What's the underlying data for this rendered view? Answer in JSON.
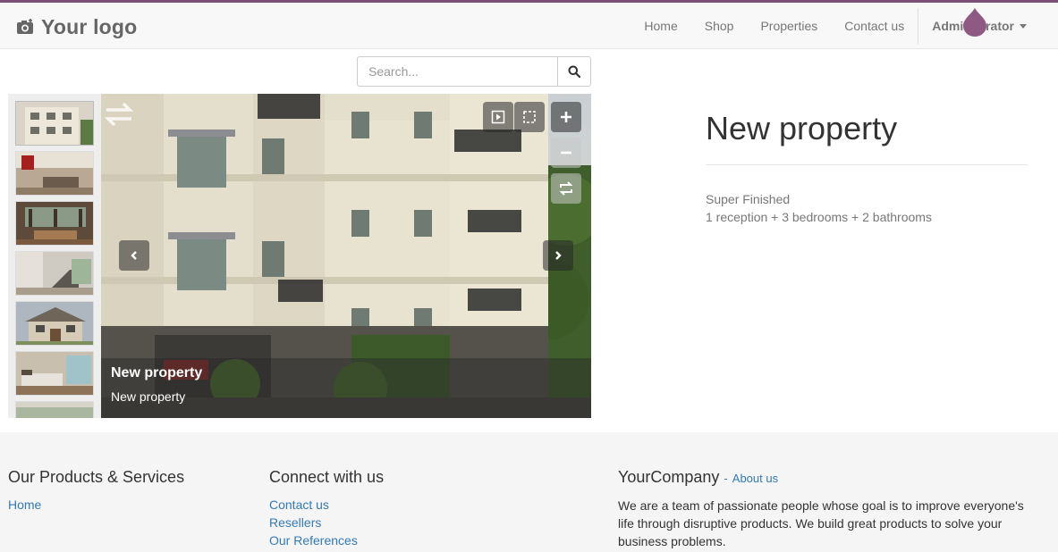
{
  "header": {
    "logo_text": "Your logo",
    "nav": [
      "Home",
      "Shop",
      "Properties",
      "Contact us"
    ],
    "user_menu": "Administrator"
  },
  "search": {
    "placeholder": "Search..."
  },
  "gallery": {
    "caption_title": "New property",
    "caption_subtitle": "New property"
  },
  "product": {
    "title": "New property",
    "line1": "Super Finished",
    "line2": "1 reception + 3 bedrooms + 2 bathrooms"
  },
  "footer": {
    "col1": {
      "title": "Our Products & Services",
      "links": [
        "Home"
      ]
    },
    "col2": {
      "title": "Connect with us",
      "links": [
        "Contact us",
        "Resellers",
        "Our References"
      ]
    },
    "col3": {
      "title": "YourCompany",
      "about_link": "About us",
      "text": "We are a team of passionate people whose goal is to improve everyone's life through disruptive products. We build great products to solve your business problems."
    }
  },
  "colors": {
    "brand": "#7c4f74",
    "link": "#337ab7"
  }
}
